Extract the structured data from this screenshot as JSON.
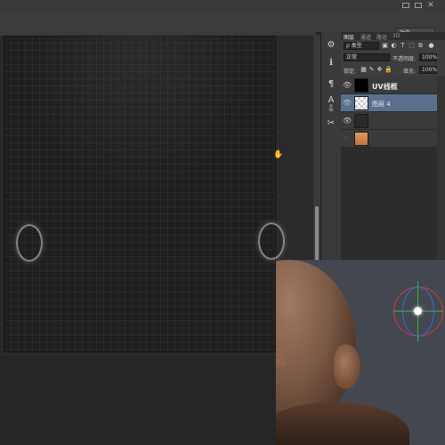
{
  "workspace": {
    "label": "功能",
    "arrow": "▾"
  },
  "panel": {
    "tabs": [
      "图层",
      "通道",
      "路径",
      "3D"
    ],
    "filter_kind": "ρ 类型",
    "blend_mode": "正常",
    "opacity_label": "不透明度:",
    "opacity_value": "100%",
    "lock_label": "锁定:",
    "fill_label": "填充:",
    "fill_value": "100%",
    "layers": [
      {
        "name": "UV线框",
        "bold": true,
        "selected": false,
        "visible": true,
        "thumb": "#000000"
      },
      {
        "name": "图层 4",
        "bold": false,
        "selected": true,
        "visible": true,
        "thumb": "checker"
      },
      {
        "name": "",
        "bold": false,
        "selected": false,
        "visible": true,
        "thumb": "#2a2a2a"
      },
      {
        "name": "",
        "bold": false,
        "selected": false,
        "visible": false,
        "thumb": "#d48a5a"
      }
    ]
  },
  "icons": {
    "eye": "👁",
    "tools": [
      "⚙",
      "ℹ",
      "¶",
      "A",
      "⇩",
      "✂"
    ]
  },
  "colors": {
    "selection": "#5a6f8e",
    "gizmo_x": "#d23a3a",
    "gizmo_y": "#3ab04a",
    "gizmo_z": "#3a6ad8"
  }
}
